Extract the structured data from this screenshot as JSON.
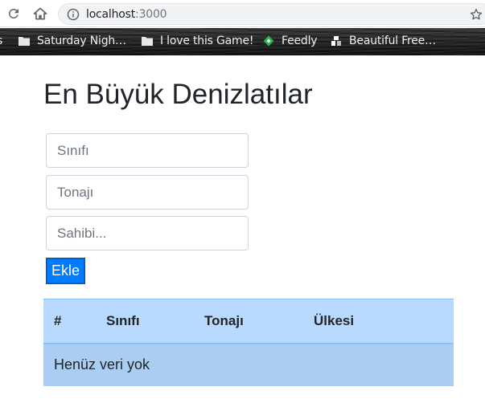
{
  "browser": {
    "url_host": "localhost",
    "url_port": ":3000",
    "bookmarks": [
      {
        "label": "s",
        "icon": "folder-icon"
      },
      {
        "label": "Saturday Nigh…",
        "icon": "folder-icon"
      },
      {
        "label": "I love this Game!",
        "icon": "folder-icon"
      },
      {
        "label": "Feedly",
        "icon": "feedly-icon"
      },
      {
        "label": "Beautiful Free…",
        "icon": "site-favicon-icon"
      }
    ]
  },
  "page": {
    "title": "En Büyük Denizlatılar",
    "form": {
      "class_placeholder": "Sınıfı",
      "tonnage_placeholder": "Tonajı",
      "owner_placeholder": "Sahibi...",
      "add_label": "Ekle"
    },
    "table": {
      "headers": [
        "#",
        "Sınıfı",
        "Tonajı",
        "Ülkesi"
      ],
      "empty_message": "Henüz veri yok"
    }
  },
  "colors": {
    "primary": "#007bff",
    "table_header": "#b8daff",
    "table_row": "#abcdf2"
  }
}
